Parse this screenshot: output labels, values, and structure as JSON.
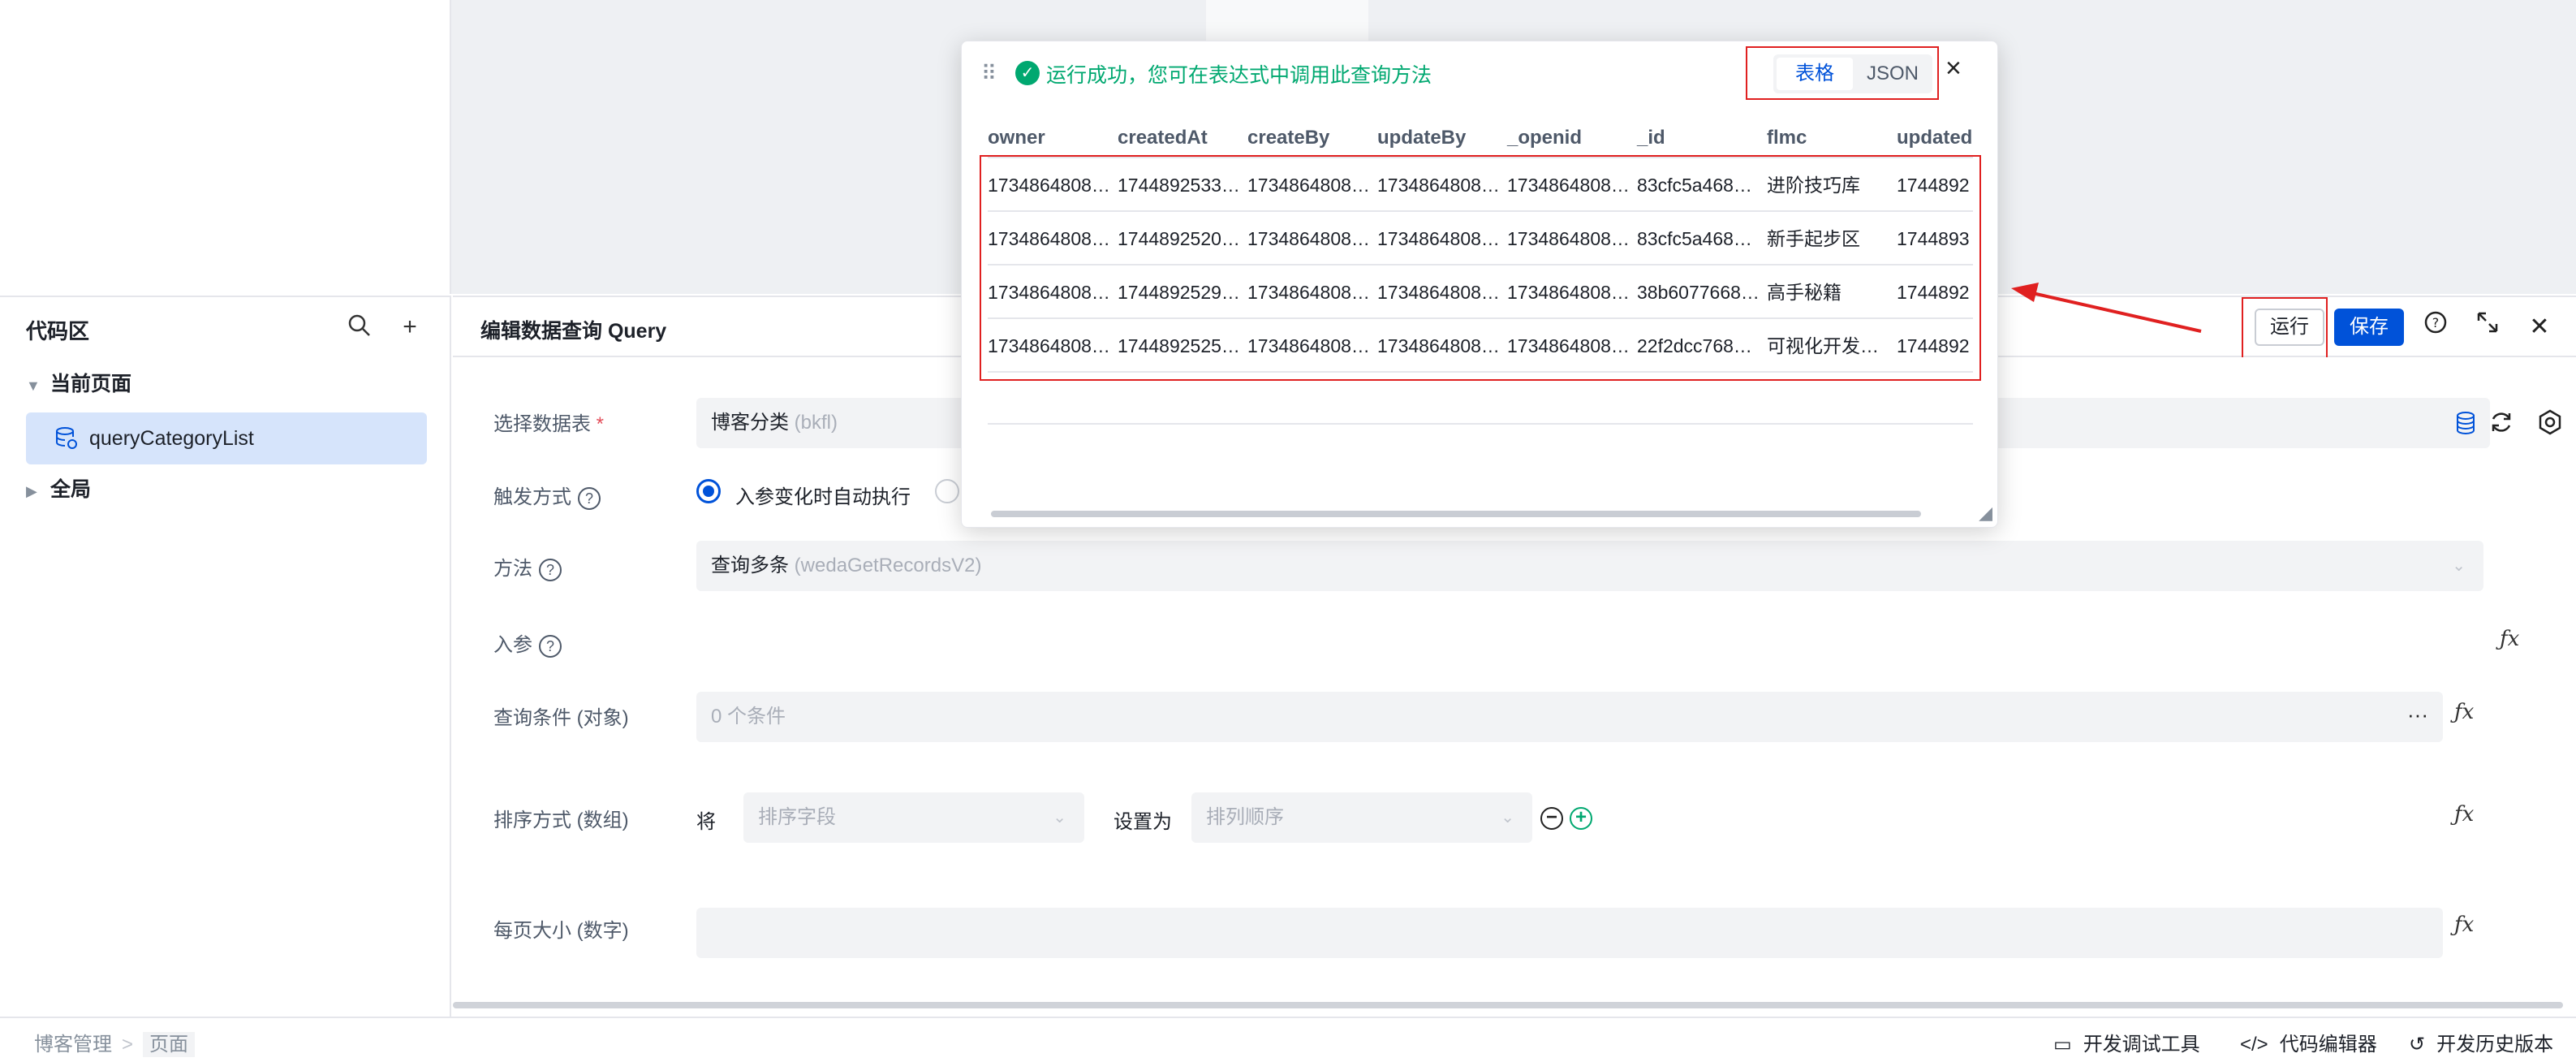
{
  "code_panel": {
    "title": "代码区",
    "tree": {
      "current_page": "当前页面",
      "selected_item": "queryCategoryList",
      "global": "全局"
    }
  },
  "editor": {
    "title": "编辑数据查询 Query",
    "run_label": "运行",
    "save_label": "保存"
  },
  "form": {
    "table_label": "选择数据表",
    "table_required": "*",
    "table_value": "博客分类",
    "table_sub": "(bkfl)",
    "trigger_label": "触发方式",
    "trigger_option": "入参变化时自动执行",
    "method_label": "方法",
    "method_value": "查询多条",
    "method_sub": "(wedaGetRecordsV2)",
    "params_label": "入参",
    "query_label": "查询条件 (对象)",
    "query_placeholder": "0 个条件",
    "query_more": "···",
    "sort_label": "排序方式 (数组)",
    "sort_prefix": "将",
    "sort_field_placeholder": "排序字段",
    "sort_set_to": "设置为",
    "sort_order_placeholder": "排列顺序",
    "page_size_label": "每页大小 (数字)"
  },
  "result_popup": {
    "message": "运行成功，您可在表达式中调用此查询方法",
    "tab_table": "表格",
    "tab_json": "JSON",
    "columns": [
      "owner",
      "createdAt",
      "createBy",
      "updateBy",
      "_openid",
      "_id",
      "flmc",
      "updated"
    ],
    "rows": [
      [
        "1734864808…",
        "1744892533…",
        "1734864808…",
        "1734864808…",
        "1734864808…",
        "83cfc5a468…",
        "进阶技巧库",
        "1744892"
      ],
      [
        "1734864808…",
        "1744892520…",
        "1734864808…",
        "1734864808…",
        "1734864808…",
        "83cfc5a468…",
        "新手起步区",
        "1744893"
      ],
      [
        "1734864808…",
        "1744892529…",
        "1734864808…",
        "1734864808…",
        "1734864808…",
        "38b6077668…",
        "高手秘籍",
        "1744892"
      ],
      [
        "1734864808…",
        "1744892525…",
        "1734864808…",
        "1734864808…",
        "1734864808…",
        "22f2dcc768…",
        "可视化开发…",
        "1744892"
      ]
    ]
  },
  "status_bar": {
    "breadcrumb": [
      "博客管理",
      "页面"
    ],
    "dev_tools": "开发调试工具",
    "code_editor": "代码编辑器",
    "history": "开发历史版本"
  },
  "colors": {
    "primary": "#0052d9",
    "success": "#00a870",
    "highlight": "#e02020"
  }
}
